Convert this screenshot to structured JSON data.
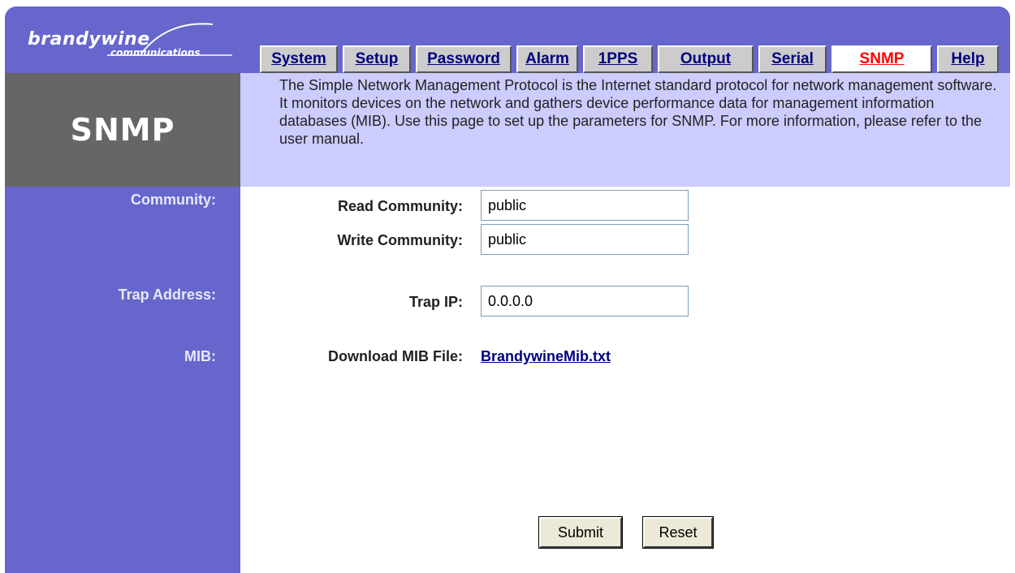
{
  "brand": {
    "name": "brandywine",
    "tagline": "communications"
  },
  "tabs": [
    {
      "label": "System",
      "active": false
    },
    {
      "label": "Setup",
      "active": false
    },
    {
      "label": "Password",
      "active": false
    },
    {
      "label": "Alarm",
      "active": false
    },
    {
      "label": "1PPS",
      "active": false
    },
    {
      "label": "Output",
      "active": false
    },
    {
      "label": "Serial",
      "active": false
    },
    {
      "label": "SNMP",
      "active": true
    },
    {
      "label": "Help",
      "active": false
    }
  ],
  "page": {
    "title": "SNMP",
    "description": "The Simple Network Management Protocol is the Internet standard protocol for network management software. It monitors devices on the network and gathers device performance data for management information databases (MIB). Use this page to set up the parameters for SNMP. For more information, please refer to the user manual."
  },
  "sections": {
    "community": "Community:",
    "trap": "Trap Address:",
    "mib": "MIB:"
  },
  "fields": {
    "read_community": {
      "label": "Read Community:",
      "value": "public"
    },
    "write_community": {
      "label": "Write Community:",
      "value": "public"
    },
    "trap_ip": {
      "label": "Trap IP:",
      "value": "0.0.0.0"
    },
    "mib_download": {
      "label": "Download MIB File:",
      "link_text": "BrandywineMib.txt"
    }
  },
  "buttons": {
    "submit": "Submit",
    "reset": "Reset"
  },
  "colors": {
    "header": "#6666cc",
    "title_box": "#666666",
    "description_bg": "#ccccff",
    "active_tab_text": "#ff0000",
    "link": "#000080"
  }
}
